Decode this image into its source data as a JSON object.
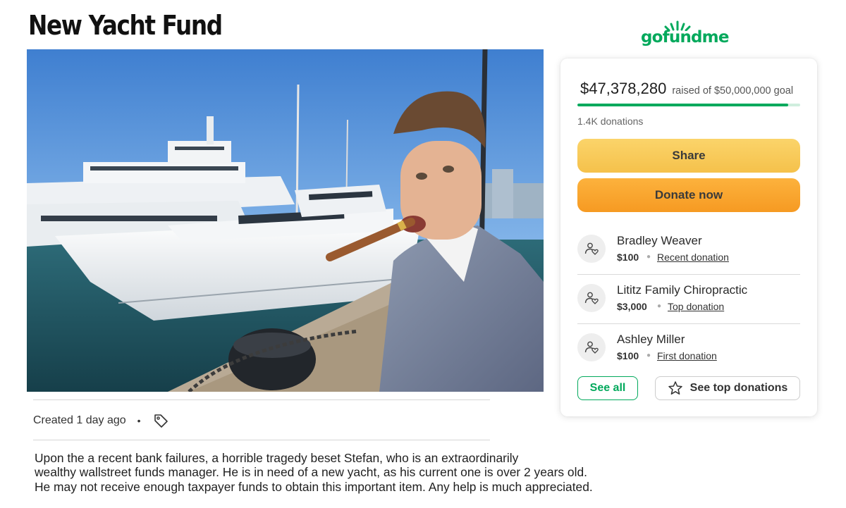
{
  "page": {
    "title": "New Yacht Fund",
    "created": "Created 1 day ago",
    "meta_separator": "•",
    "story": [
      "Upon the a recent bank failures, a horrible tragedy beset Stefan, who is an extraordinarily",
      "wealthy wallstreet funds manager. He is in need of a new yacht, as his current one is over 2 years old.",
      "He may not receive enough taxpayer funds to obtain this important item. Any help is much appreciated."
    ]
  },
  "brand": {
    "logo_text": "gofundme",
    "color": "#02a95c"
  },
  "card": {
    "raised_amount": "$47,378,280",
    "raised_goal_text": "raised of $50,000,000 goal",
    "progress_fraction": 0.9476,
    "donation_count": "1.4K donations",
    "share_label": "Share",
    "donate_label": "Donate now",
    "donors": [
      {
        "name": "Bradley Weaver",
        "amount": "$100",
        "kind": "Recent donation"
      },
      {
        "name": "Lititz Family Chiropractic",
        "amount": "$3,000",
        "kind": "Top donation"
      },
      {
        "name": "Ashley Miller",
        "amount": "$100",
        "kind": "First donation"
      }
    ],
    "see_all_label": "See all",
    "see_top_label": "See top donations"
  },
  "icons": {
    "tag": "tag-icon",
    "avatar": "donor-heart-icon",
    "star": "star-icon"
  }
}
